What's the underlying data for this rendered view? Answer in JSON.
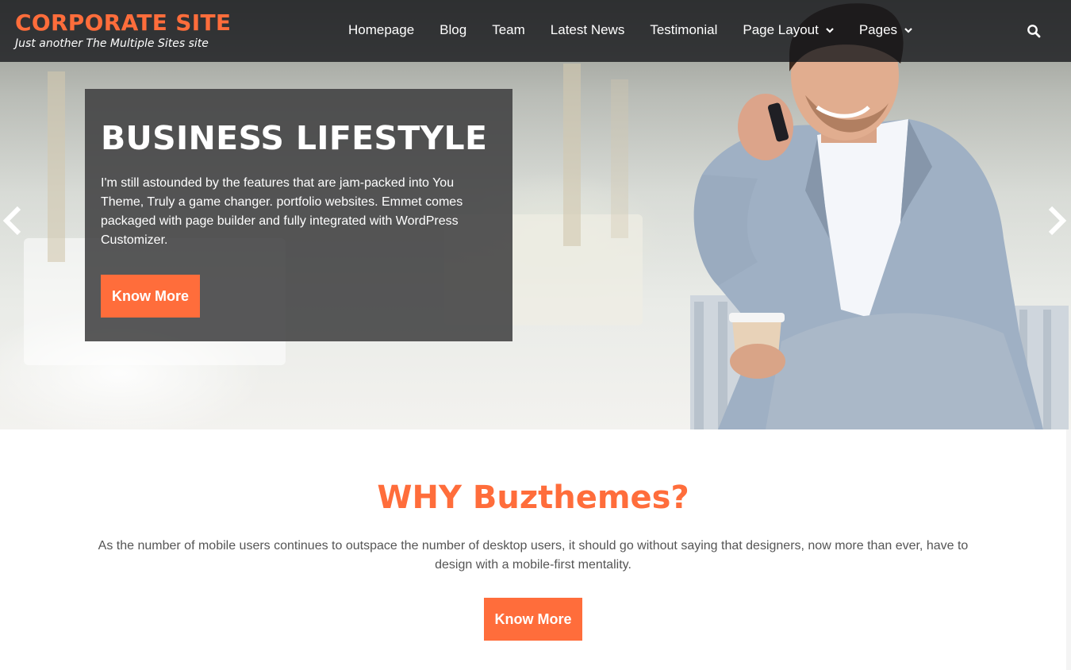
{
  "site": {
    "title": "CORPORATE SITE",
    "tagline": "Just another The Multiple Sites site"
  },
  "nav": {
    "items": [
      {
        "label": "Homepage",
        "dropdown": false
      },
      {
        "label": "Blog",
        "dropdown": false
      },
      {
        "label": "Team",
        "dropdown": false
      },
      {
        "label": "Latest News",
        "dropdown": false
      },
      {
        "label": "Testimonial",
        "dropdown": false
      },
      {
        "label": "Page Layout",
        "dropdown": true
      },
      {
        "label": "Pages",
        "dropdown": true
      }
    ],
    "search_icon": "search-icon"
  },
  "slider": {
    "title": "BUSINESS LIFESTYLE",
    "text": "I'm still astounded by the features that are jam-packed into You Theme, Truly a game changer. portfolio websites. Emmet comes packaged with page builder and fully integrated with WordPress Customizer.",
    "button_label": "Know More",
    "prev_icon": "chevron-left-icon",
    "next_icon": "chevron-right-icon"
  },
  "why": {
    "title": "WHY Buzthemes?",
    "text": "As the number of mobile users continues to outspace the number of desktop users, it should go without saying that designers, now more than ever, have to design with a mobile-first mentality.",
    "button_label": "Know More"
  },
  "colors": {
    "accent": "#ff6d3b",
    "header_bg": "#16181c",
    "caption_bg": "#3c3c3e",
    "body_text": "#555555"
  }
}
